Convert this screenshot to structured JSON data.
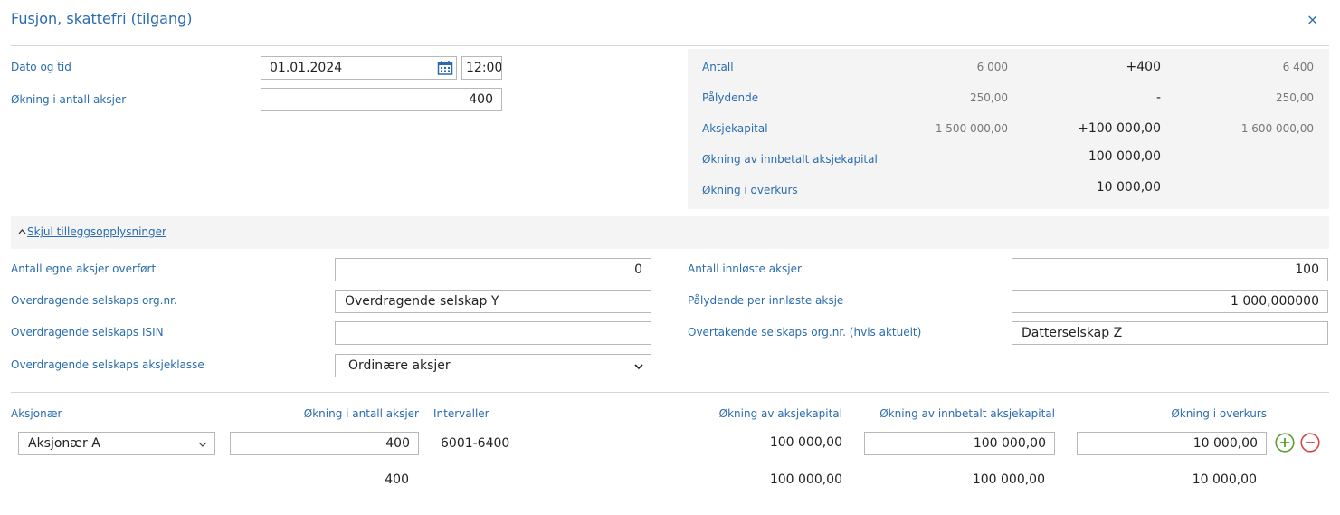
{
  "dialog": {
    "title": "Fusjon, skattefri (tilgang)",
    "close_symbol": "×"
  },
  "form": {
    "date_label": "Dato og tid",
    "date_value": "01.01.2024",
    "time_value": "12:00",
    "increase_label": "Økning i antall aksjer",
    "increase_value": "400"
  },
  "summary": {
    "rows": [
      {
        "label": "Antall",
        "before": "6 000",
        "change": "+400",
        "after": "6 400"
      },
      {
        "label": "Pålydende",
        "before": "250,00",
        "change": "-",
        "after": "250,00"
      },
      {
        "label": "Aksjekapital",
        "before": "1 500 000,00",
        "change": "+100 000,00",
        "after": "1 600 000,00"
      },
      {
        "label": "Økning av innbetalt aksjekapital",
        "before": "",
        "change": "100 000,00",
        "after": ""
      },
      {
        "label": "Økning i overkurs",
        "before": "",
        "change": "10 000,00",
        "after": ""
      }
    ]
  },
  "toggle": {
    "label": "Skjul tilleggsopplysninger"
  },
  "extra": {
    "left": [
      {
        "label": "Antall egne aksjer overført",
        "value": "0"
      },
      {
        "label": "Overdragende selskaps org.nr.",
        "value": "Overdragende selskap Y"
      },
      {
        "label": "Overdragende selskaps ISIN",
        "value": ""
      },
      {
        "label": "Overdragende selskaps aksjeklasse",
        "value": "Ordinære aksjer"
      }
    ],
    "right": [
      {
        "label": "Antall innløste aksjer",
        "value": "100"
      },
      {
        "label": "Pålydende per innløste aksje",
        "value": "1 000,000000"
      },
      {
        "label": "Overtakende selskaps org.nr. (hvis aktuelt)",
        "value": "Datterselskap Z"
      }
    ]
  },
  "table": {
    "headers": {
      "shareholder": "Aksjonær",
      "increase": "Økning i antall aksjer",
      "intervals": "Intervaller",
      "capital": "Økning av aksjekapital",
      "paid_in": "Økning av innbetalt aksjekapital",
      "premium": "Økning i overkurs"
    },
    "row": {
      "shareholder": "Aksjonær A",
      "increase": "400",
      "intervals": "6001-6400",
      "capital": "100 000,00",
      "paid_in": "100 000,00",
      "premium": "10 000,00"
    },
    "totals": {
      "increase": "400",
      "capital": "100 000,00",
      "paid_in": "100 000,00",
      "premium": "10 000,00"
    }
  },
  "colors": {
    "accent": "#2a6cae",
    "add": "#5aa02c",
    "remove": "#d64545"
  }
}
